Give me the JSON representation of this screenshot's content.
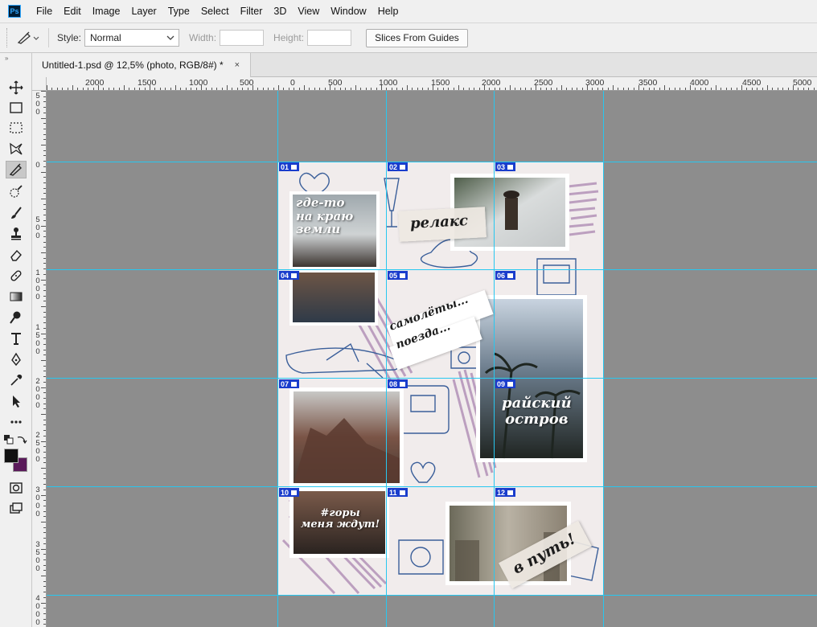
{
  "app": {
    "logo": "Ps"
  },
  "menu": [
    "File",
    "Edit",
    "Image",
    "Layer",
    "Type",
    "Select",
    "Filter",
    "3D",
    "View",
    "Window",
    "Help"
  ],
  "options": {
    "style_label": "Style:",
    "style_value": "Normal",
    "width_label": "Width:",
    "height_label": "Height:",
    "slices_button": "Slices From Guides"
  },
  "tab": {
    "title": "Untitled-1.psd @ 12,5% (photo, RGB/8#) *",
    "close": "×"
  },
  "ruler": {
    "h_labels": [
      "2000",
      "1500",
      "1000",
      "500",
      "0",
      "500",
      "1000",
      "1500",
      "2000",
      "2500",
      "3000",
      "3500",
      "4000",
      "4500",
      "5000"
    ],
    "v_labels": [
      "500",
      "0",
      "500",
      "1000",
      "1500",
      "2000",
      "2500",
      "3000",
      "3500",
      "4000"
    ]
  },
  "slices": [
    "01",
    "02",
    "03",
    "04",
    "05",
    "06",
    "07",
    "08",
    "09",
    "10",
    "11",
    "12"
  ],
  "artwork": {
    "t1": "где-то\nна краю\nземли",
    "t2": "релакс",
    "t3": "самолёты...\nпоезда...",
    "t4": "райский\nостров",
    "t5": "#горы\nменя ждут!",
    "t6": "в путь!"
  },
  "colors": {
    "guide": "#27c7f0",
    "slice_badge": "#1a3dcc",
    "canvas_bg": "#8d8d8d",
    "foreground": "#111111",
    "background": "#5a1a5a"
  },
  "tools": [
    "move-tool-icon",
    "marquee-tool-icon",
    "lasso-tool-icon",
    "quick-selection-icon",
    "slice-tool-icon",
    "spot-healing-icon",
    "brush-tool-icon",
    "clone-stamp-icon",
    "eraser-tool-icon",
    "bandage-icon",
    "gradient-tool-icon",
    "dodge-tool-icon",
    "type-tool-icon",
    "pen-tool-icon",
    "eyedropper-icon",
    "path-selection-icon",
    "more-tools-icon"
  ]
}
